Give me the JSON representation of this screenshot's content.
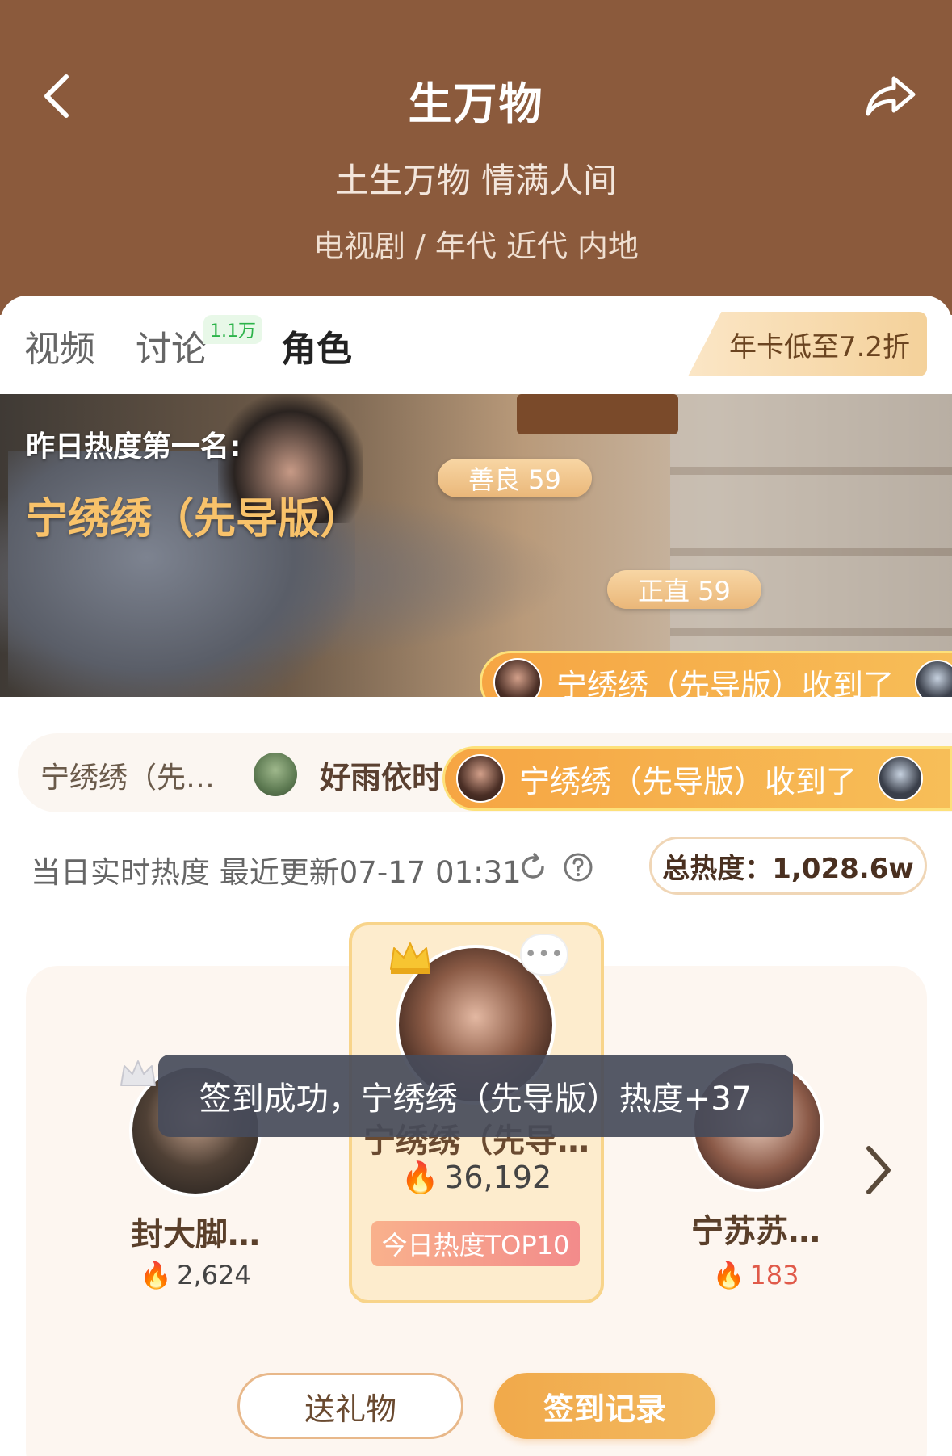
{
  "header": {
    "title": "生万物",
    "subtitle": "土生万物 情满人间",
    "meta": "电视剧 / 年代 近代 内地",
    "bg_color": "#8b5a3c"
  },
  "tabs": [
    {
      "label": "视频"
    },
    {
      "label": "讨论",
      "badge": "1.1万"
    },
    {
      "label": "角色",
      "active": true
    }
  ],
  "promo": {
    "label": "年卡低至7.2折"
  },
  "banner": {
    "label": "昨日热度第一名:",
    "name": "宁绣绣（先导版）",
    "traits": [
      {
        "label": "善良 59"
      },
      {
        "label": "正直 59"
      }
    ],
    "gift_toast": "宁绣绣（先导版）收到了"
  },
  "marquee": {
    "name": "宁绣绣（先…",
    "gift": "好雨依时",
    "gift_toast": "宁绣绣（先导版）收到了"
  },
  "realtime": {
    "label": "当日实时热度 最近更新07-17 01:31",
    "total": "总热度：1,028.6w"
  },
  "ranking": {
    "center": {
      "name": "宁绣绣（先导…",
      "heat": "36,192",
      "badge": "今日热度TOP10",
      "more": "•••"
    },
    "left": {
      "name": "封大脚…",
      "heat": "2,624"
    },
    "right": {
      "name": "宁苏苏…",
      "heat": "183"
    }
  },
  "toast": "签到成功，宁绣绣（先导版）热度+37",
  "buttons": {
    "gift": "送礼物",
    "record": "签到记录"
  },
  "colors": {
    "accent": "#f1a94a",
    "header_bg": "#8b5a3c"
  }
}
